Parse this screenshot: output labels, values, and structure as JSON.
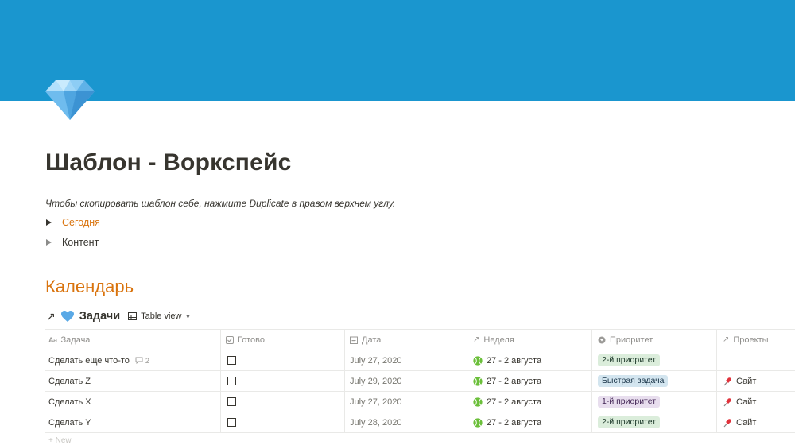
{
  "page": {
    "icon": "gem-icon",
    "cover_color": "#1a96cf",
    "title": "Шаблон - Воркспейс",
    "intro": "Чтобы скопировать шаблон себе, нажмите Duplicate в правом верхнем углу."
  },
  "toggles": [
    {
      "label": "Сегодня",
      "color": "#d9730d"
    },
    {
      "label": "Контент",
      "color": "#37352f"
    }
  ],
  "section": {
    "heading": "Календарь",
    "color": "#d9730d"
  },
  "database": {
    "link_icon": "arrow-up-right-icon",
    "emoji": "blue-heart-icon",
    "title": "Задачи",
    "view_label": "Table view",
    "columns": [
      {
        "label": "Задача",
        "icon": "text-aa-icon"
      },
      {
        "label": "Готово",
        "icon": "checkbox-icon"
      },
      {
        "label": "Дата",
        "icon": "calendar-icon"
      },
      {
        "label": "Неделя",
        "icon": "relation-arrow-icon"
      },
      {
        "label": "Приоритет",
        "icon": "select-icon"
      },
      {
        "label": "Проекты",
        "icon": "relation-arrow-icon"
      }
    ],
    "rows": [
      {
        "task": "Сделать еще что-то",
        "comments": "2",
        "done": false,
        "date": "July 27, 2020",
        "week": "27 - 2 августа",
        "priority": "2-й приоритет",
        "priority_color": "green",
        "project": ""
      },
      {
        "task": "Сделать Z",
        "comments": "",
        "done": false,
        "date": "July 29, 2020",
        "week": "27 - 2 августа",
        "priority": "Быстрая задача",
        "priority_color": "blue",
        "project": "Сайт"
      },
      {
        "task": "Сделать X",
        "comments": "",
        "done": false,
        "date": "July 27, 2020",
        "week": "27 - 2 августа",
        "priority": "1-й приоритет",
        "priority_color": "purple",
        "project": "Сайт"
      },
      {
        "task": "Сделать Y",
        "comments": "",
        "done": false,
        "date": "July 28, 2020",
        "week": "27 - 2 августа",
        "priority": "2-й приоритет",
        "priority_color": "green",
        "project": "Сайт"
      }
    ],
    "new_label": "+ New"
  }
}
